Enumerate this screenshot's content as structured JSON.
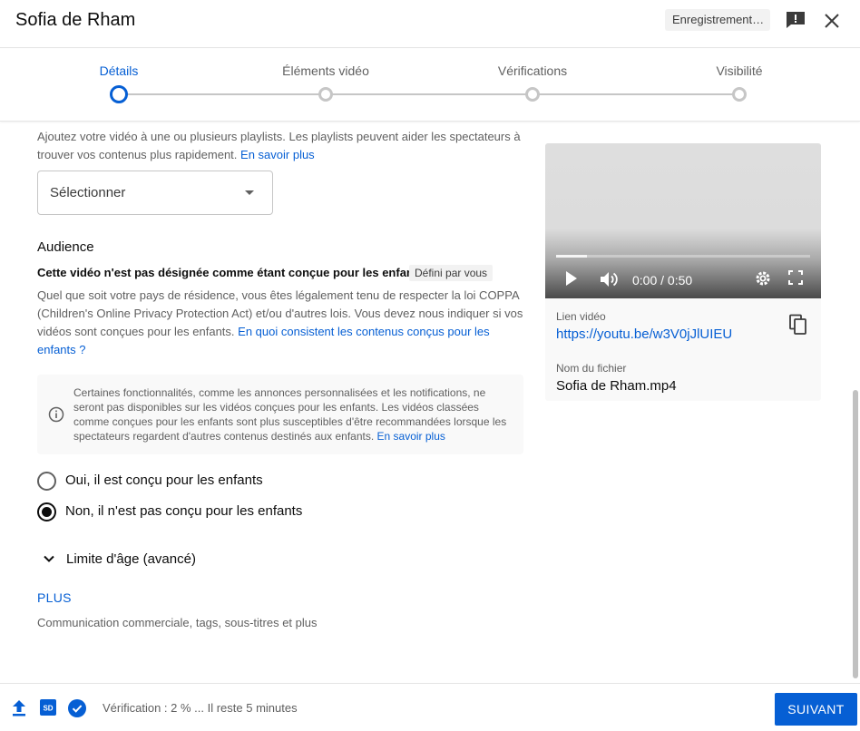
{
  "header": {
    "title": "Sofia de Rham",
    "saving_label": "Enregistrement…"
  },
  "stepper": {
    "steps": [
      {
        "label": "Détails",
        "active": true
      },
      {
        "label": "Éléments vidéo",
        "active": false
      },
      {
        "label": "Vérifications",
        "active": false
      },
      {
        "label": "Visibilité",
        "active": false
      }
    ]
  },
  "playlists": {
    "description": "Ajoutez votre vidéo à une ou plusieurs playlists. Les playlists peuvent aider les spectateurs à trouver vos contenus plus rapidement.",
    "learn_more": "En savoir plus",
    "select_placeholder": "Sélectionner"
  },
  "audience": {
    "title": "Audience",
    "subtitle": "Cette vidéo n'est pas désignée comme étant conçue pour les enfants",
    "defined_chip": "Défini par vous",
    "description": "Quel que soit votre pays de résidence, vous êtes légalement tenu de respecter la loi COPPA (Children's Online Privacy Protection Act) et/ou d'autres lois. Vous devez nous indiquer si vos vidéos sont conçues pour les enfants.",
    "description_link": "En quoi consistent les contenus conçus pour les enfants ?",
    "info_text": "Certaines fonctionnalités, comme les annonces personnalisées et les notifications, ne seront pas disponibles sur les vidéos conçues pour les enfants. Les vidéos classées comme conçues pour les enfants sont plus susceptibles d'être recommandées lorsque les spectateurs regardent d'autres contenus destinés aux enfants.",
    "info_link": "En savoir plus",
    "option_yes": "Oui, il est conçu pour les enfants",
    "option_no": "Non, il n'est pas conçu pour les enfants",
    "selected": "no",
    "age_restriction": "Limite d'âge (avancé)"
  },
  "more": {
    "label": "PLUS",
    "description": "Communication commerciale, tags, sous-titres et plus"
  },
  "video_card": {
    "time": "0:00 / 0:50",
    "progress": 0.12,
    "link_label": "Lien vidéo",
    "link": "https://youtu.be/w3V0jJlUIEU",
    "file_label": "Nom du fichier",
    "file_name": "Sofia de Rham.mp4"
  },
  "footer": {
    "status": "Vérification : 2 % ... Il reste 5 minutes",
    "next_button": "SUIVANT",
    "hd_badge": "SD"
  },
  "colors": {
    "accent": "#065fd4",
    "text_secondary": "#606060"
  }
}
